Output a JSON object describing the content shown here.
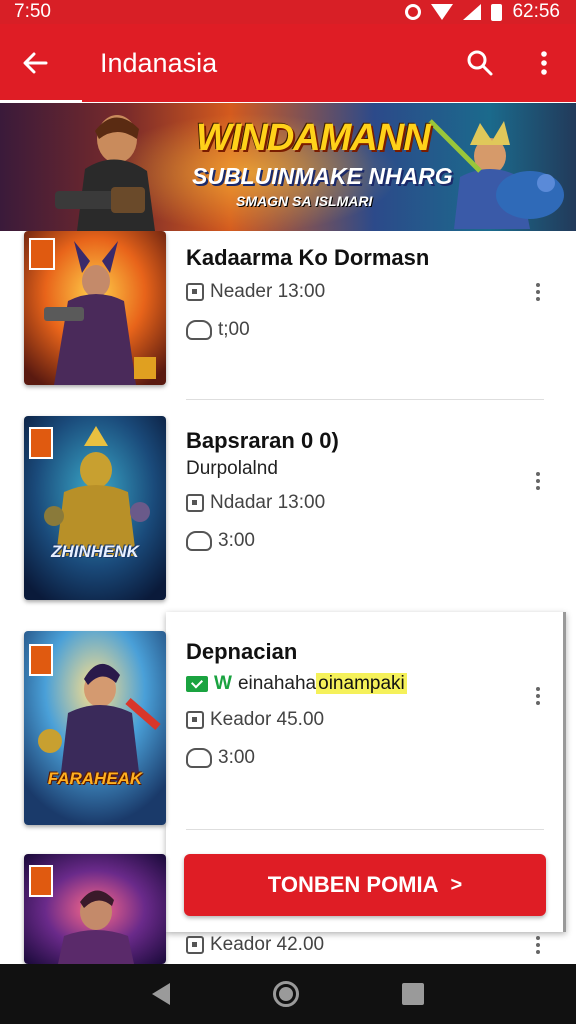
{
  "status_bar": {
    "time": "7:50",
    "clock_right": "62:56"
  },
  "app_bar": {
    "title": "Indanasia",
    "back_icon": "arrow-left-icon",
    "search_icon": "search-icon",
    "menu_icon": "more-vert-icon"
  },
  "banner": {
    "title": "WINDAMANN",
    "subtitle": "SUBLUINMAKE NHARG",
    "small_text": "SMAGN SA ISLMARI"
  },
  "games": [
    {
      "title": "Kadaarma Ko Dormasn",
      "date": "Neader 13:00",
      "size": "t;00"
    },
    {
      "title": "Bapsraran 0 0)",
      "subtitle": "Durpolalnd",
      "date": "Ndadar 13:00",
      "size": "3:00",
      "cover_text": "ZHINHENK"
    },
    {
      "title": "Depnacian",
      "verified_letter": "W",
      "verified_text": "einahaha",
      "verified_highlight": "oinampaki",
      "date": "Keador 45.00",
      "size": "3:00",
      "cover_text": "FARAHEAK"
    },
    {
      "date": "Keador 42.00"
    }
  ],
  "cta": {
    "label": "TONBEN POMIA",
    "arrow": ">"
  },
  "colors": {
    "brand_red": "#df1d25",
    "verified_green": "#1aa340",
    "highlight_yellow": "#f5f15a"
  }
}
